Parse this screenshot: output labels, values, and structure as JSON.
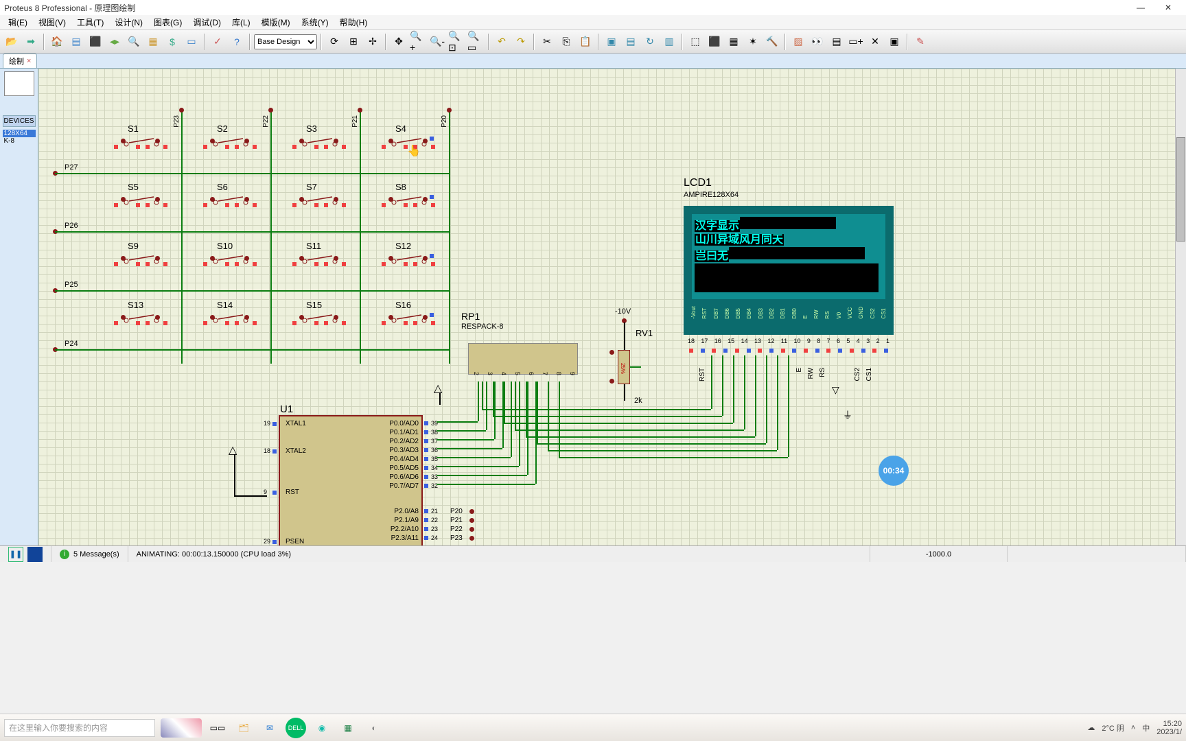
{
  "title": "Proteus 8 Professional - 原理图绘制",
  "menu": [
    "辑(E)",
    "视图(V)",
    "工具(T)",
    "设计(N)",
    "图表(G)",
    "调试(D)",
    "库(L)",
    "模版(M)",
    "系统(Y)",
    "帮助(H)"
  ],
  "design_dropdown": "Base Design",
  "tab": {
    "name": "绘制",
    "close": "×"
  },
  "sidebar": {
    "devices_header": "DEVICES",
    "items": [
      "128X64",
      "",
      "K-8"
    ]
  },
  "switches": {
    "row1": [
      "S1",
      "S2",
      "S3",
      "S4"
    ],
    "row2": [
      "S5",
      "S6",
      "S7",
      "S8"
    ],
    "row3": [
      "S9",
      "S10",
      "S11",
      "S12"
    ],
    "row4": [
      "S13",
      "S14",
      "S15",
      "S16"
    ]
  },
  "col_labels": [
    "P23",
    "P22",
    "P21",
    "P20"
  ],
  "row_labels": [
    "P27",
    "P26",
    "P25",
    "P24"
  ],
  "lcd": {
    "ref": "LCD1",
    "part": "AMPIRE128X64",
    "line1": "汉字显示",
    "line2": "山川异域风月同天",
    "line3": "岂曰无",
    "pin_labels": [
      "-Vout",
      "RST",
      "DB7",
      "DB6",
      "DB5",
      "DB4",
      "DB3",
      "DB2",
      "DB1",
      "DB0",
      "E",
      "RW",
      "RS",
      "V0",
      "VCC",
      "GND",
      "CS2",
      "CS1"
    ],
    "pin_nums": [
      "18",
      "17",
      "16",
      "15",
      "14",
      "13",
      "12",
      "11",
      "10",
      "9",
      "8",
      "7",
      "6",
      "5",
      "4",
      "3",
      "2",
      "1"
    ]
  },
  "rv1": {
    "ref": "RV1",
    "supply": "-10V",
    "value": "2k"
  },
  "rp1": {
    "ref": "RP1",
    "part": "RESPACK-8",
    "pins": [
      "2",
      "3",
      "4",
      "5",
      "6",
      "7",
      "8",
      "9"
    ]
  },
  "u1": {
    "ref": "U1",
    "left": [
      {
        "num": "19",
        "name": "XTAL1"
      },
      {
        "num": "18",
        "name": "XTAL2"
      },
      {
        "num": "9",
        "name": "RST"
      },
      {
        "num": "29",
        "name": "PSEN"
      }
    ],
    "right": [
      {
        "num": "39",
        "name": "P0.0/AD0"
      },
      {
        "num": "38",
        "name": "P0.1/AD1"
      },
      {
        "num": "37",
        "name": "P0.2/AD2"
      },
      {
        "num": "36",
        "name": "P0.3/AD3"
      },
      {
        "num": "35",
        "name": "P0.4/AD4"
      },
      {
        "num": "34",
        "name": "P0.5/AD5"
      },
      {
        "num": "33",
        "name": "P0.6/AD6"
      },
      {
        "num": "32",
        "name": "P0.7/AD7"
      },
      {
        "num": "21",
        "name": "P2.0/A8"
      },
      {
        "num": "22",
        "name": "P2.1/A9"
      },
      {
        "num": "23",
        "name": "P2.2/A10"
      },
      {
        "num": "24",
        "name": "P2.3/A11"
      }
    ],
    "right_nets": [
      "P20",
      "P21",
      "P22",
      "P23"
    ]
  },
  "lcd_vpins": [
    "RST",
    "E",
    "RW",
    "RS",
    "CS2",
    "CS1"
  ],
  "status": {
    "messages": "5 Message(s)",
    "sim": "ANIMATING: 00:00:13.150000 (CPU load 3%)",
    "coord": "-1000.0"
  },
  "taskbar": {
    "search_placeholder": "在这里输入你要搜索的内容",
    "weather": "2°C 阴",
    "ime": "中",
    "time": "15:20",
    "date": "2023/1/"
  },
  "timer": "00:34"
}
